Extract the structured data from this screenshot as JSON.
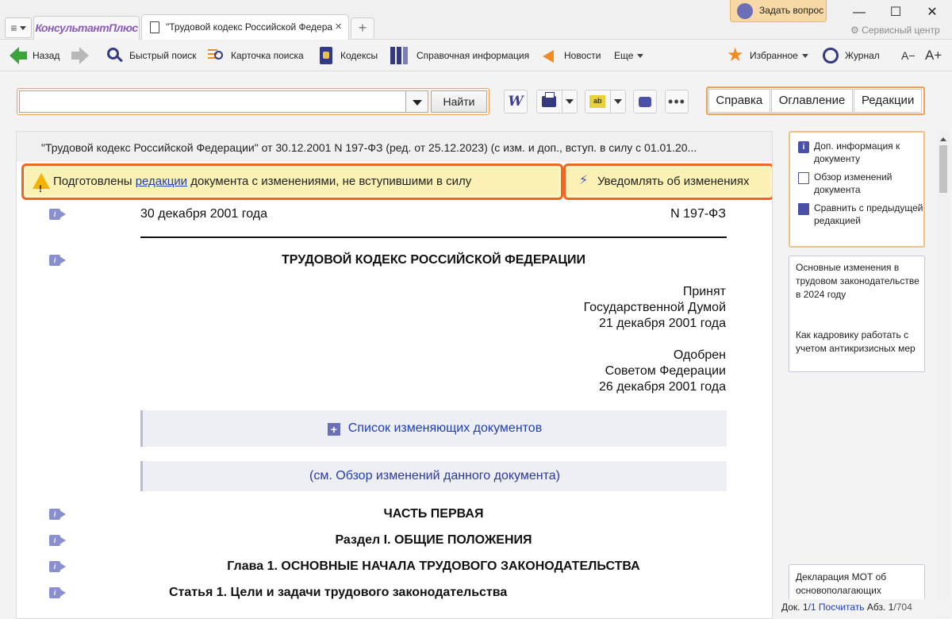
{
  "window": {
    "brand": "КонсультантПлюс",
    "tab_title": "\"Трудовой кодекс Российской Федера",
    "ask_button": "Задать вопрос",
    "minimize": "—",
    "maximize": "☐",
    "close": "✕",
    "service_center": "Сервисный центр"
  },
  "toolbar": {
    "back": "Назад",
    "quick_search": "Быстрый поиск",
    "search_card": "Карточка поиска",
    "codes": "Кодексы",
    "reference": "Справочная информация",
    "news": "Новости",
    "more": "Еще",
    "favorites": "Избранное",
    "journal": "Журнал",
    "font_smaller": "A−",
    "font_larger": "A+"
  },
  "search": {
    "value": "",
    "placeholder": "",
    "find_button": "Найти"
  },
  "right_tabs": [
    "Справка",
    "Оглавление",
    "Редакции"
  ],
  "document": {
    "header": "\"Трудовой кодекс Российской Федерации\" от 30.12.2001 N 197-ФЗ (ред. от 25.12.2023) (с изм. и доп., вступ. в силу с 01.01.20...",
    "notice_before": "Подготовлены ",
    "notice_link": "редакции",
    "notice_after": " документа с изменениями, не вступившими в силу",
    "notify_button": "Уведомлять об изменениях",
    "date": "30 декабря 2001 года",
    "number": "N 197-ФЗ",
    "title": "ТРУДОВОЙ КОДЕКС РОССИЙСКОЙ ФЕДЕРАЦИИ",
    "adopted": [
      "Принят",
      "Государственной Думой",
      "21 декабря 2001 года"
    ],
    "approved": [
      "Одобрен",
      "Советом Федерации",
      "26 декабря 2001 года"
    ],
    "changing_docs": "Список изменяющих документов",
    "see_before": "(см. ",
    "see_link": "Обзор",
    "see_after": " изменений данного документа)",
    "part": "ЧАСТЬ ПЕРВАЯ",
    "section": "Раздел I. ОБЩИЕ ПОЛОЖЕНИЯ",
    "chapter": "Глава 1. ОСНОВНЫЕ НАЧАЛА ТРУДОВОГО ЗАКОНОДАТЕЛЬСТВА",
    "article": "Статья 1. Цели и задачи трудового законодательства"
  },
  "side_panel": {
    "items": [
      "Доп. информация к документу",
      "Обзор изменений документа",
      "Сравнить с предыдущей редакцией"
    ],
    "links": [
      "Основные изменения в трудовом законодательстве в 2024 году",
      "Как кадровику работать с учетом антикризисных мер"
    ],
    "promo": "Декларация МОТ об основополагающих"
  },
  "status": {
    "doc_label": "Док.",
    "doc_current": "1",
    "doc_total": "/1",
    "count_link": "Посчитать",
    "para_label": "Абз.",
    "para_current": "1",
    "para_total": "/704"
  }
}
